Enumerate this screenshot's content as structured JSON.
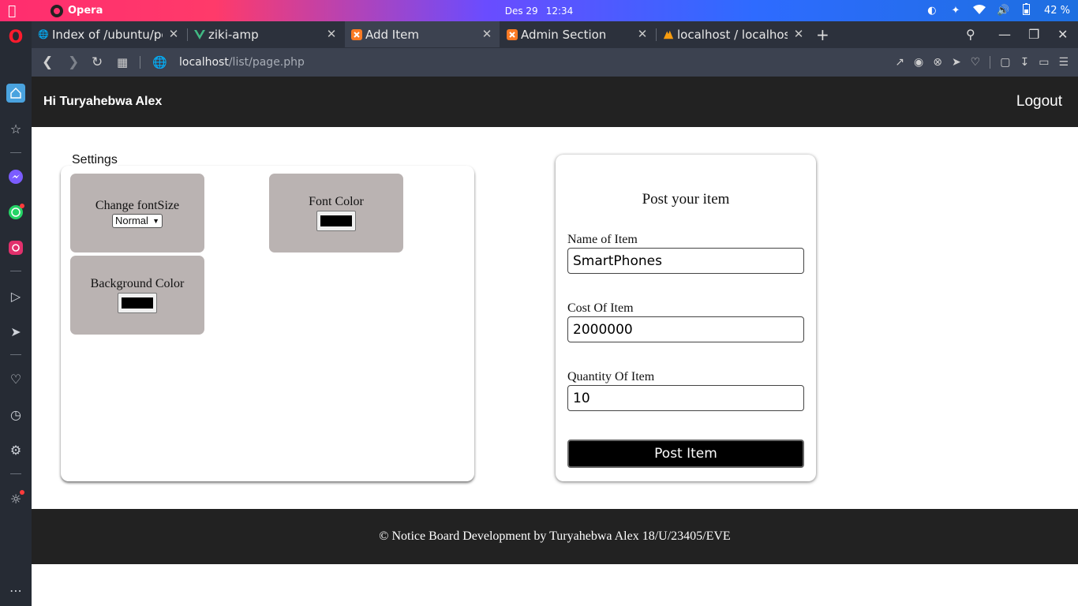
{
  "os": {
    "app_name": "Opera",
    "date": "Des 29",
    "time": "12:34",
    "battery": "42 %"
  },
  "tabs": [
    {
      "title": "Index of /ubuntu/po",
      "icon": "globe-icon"
    },
    {
      "title": "ziki-amp",
      "icon": "vue-icon"
    },
    {
      "title": "Add Item",
      "icon": "xampp-icon"
    },
    {
      "title": "Admin Section",
      "icon": "xampp-icon"
    },
    {
      "title": "localhost / localhost",
      "icon": "phpmyadmin-icon"
    }
  ],
  "address": {
    "host": "localhost",
    "path": "/list/page.php"
  },
  "header": {
    "greeting": "Hi Turyahebwa Alex",
    "logout": "Logout"
  },
  "settings": {
    "legend": "Settings",
    "font_size_label": "Change fontSize",
    "font_size_value": "Normal",
    "font_color_label": "Font Color",
    "bg_color_label": "Background Color",
    "font_color_value": "#000000",
    "bg_color_value": "#000000"
  },
  "post_form": {
    "title": "Post your item",
    "name_label": "Name of Item",
    "name_value": "SmartPhones",
    "cost_label": "Cost Of Item",
    "cost_value": "2000000",
    "qty_label": "Quantity Of Item",
    "qty_value": "10",
    "submit": "Post Item"
  },
  "footer": {
    "text": "© Notice Board Development by Turyahebwa Alex 18/U/23405/EVE"
  },
  "colors": {
    "header_bg": "#222222",
    "box_bg": "#bab3b2",
    "button_bg": "#000000"
  }
}
